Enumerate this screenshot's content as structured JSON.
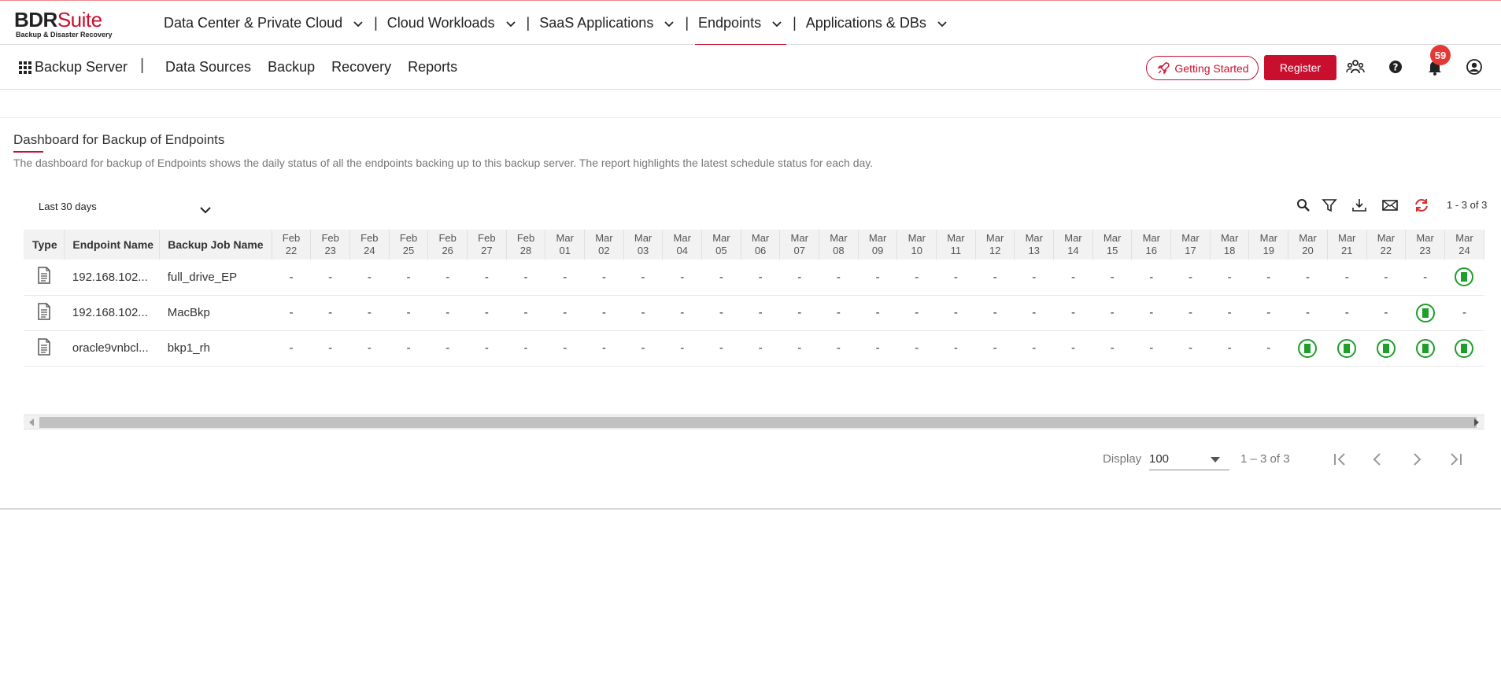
{
  "brand": {
    "name_part1": "BDR",
    "name_part2": "Suite",
    "tagline": "Backup & Disaster Recovery",
    "accent": "#c8102e"
  },
  "topnav": [
    {
      "label": "Data Center & Private Cloud",
      "active": false
    },
    {
      "label": "Cloud Workloads",
      "active": false
    },
    {
      "label": "SaaS Applications",
      "active": false
    },
    {
      "label": "Endpoints",
      "active": true
    },
    {
      "label": "Applications & DBs",
      "active": false
    }
  ],
  "subbar": {
    "server": "Backup Server",
    "nav": [
      "Data Sources",
      "Backup",
      "Recovery",
      "Reports"
    ],
    "getting_started": "Getting Started",
    "register": "Register",
    "notifications_count": "59"
  },
  "page": {
    "title": "Dashboard for Backup of Endpoints",
    "description": "The dashboard for backup of Endpoints shows the daily status of all the endpoints backing up to this backup server. The report highlights the latest schedule status for each day.",
    "range": "Last 30 days",
    "count": "1 - 3 of 3"
  },
  "table": {
    "headers": {
      "type": "Type",
      "endpoint": "Endpoint Name",
      "job": "Backup Job Name"
    },
    "dates": [
      [
        "Feb",
        "22"
      ],
      [
        "Feb",
        "23"
      ],
      [
        "Feb",
        "24"
      ],
      [
        "Feb",
        "25"
      ],
      [
        "Feb",
        "26"
      ],
      [
        "Feb",
        "27"
      ],
      [
        "Feb",
        "28"
      ],
      [
        "Mar",
        "01"
      ],
      [
        "Mar",
        "02"
      ],
      [
        "Mar",
        "03"
      ],
      [
        "Mar",
        "04"
      ],
      [
        "Mar",
        "05"
      ],
      [
        "Mar",
        "06"
      ],
      [
        "Mar",
        "07"
      ],
      [
        "Mar",
        "08"
      ],
      [
        "Mar",
        "09"
      ],
      [
        "Mar",
        "10"
      ],
      [
        "Mar",
        "11"
      ],
      [
        "Mar",
        "12"
      ],
      [
        "Mar",
        "13"
      ],
      [
        "Mar",
        "14"
      ],
      [
        "Mar",
        "15"
      ],
      [
        "Mar",
        "16"
      ],
      [
        "Mar",
        "17"
      ],
      [
        "Mar",
        "18"
      ],
      [
        "Mar",
        "19"
      ],
      [
        "Mar",
        "20"
      ],
      [
        "Mar",
        "21"
      ],
      [
        "Mar",
        "22"
      ],
      [
        "Mar",
        "23"
      ],
      [
        "Mar",
        "24"
      ]
    ],
    "rows": [
      {
        "endpoint": "192.168.102...",
        "job": "full_drive_EP",
        "status": [
          "-",
          "-",
          "-",
          "-",
          "-",
          "-",
          "-",
          "-",
          "-",
          "-",
          "-",
          "-",
          "-",
          "-",
          "-",
          "-",
          "-",
          "-",
          "-",
          "-",
          "-",
          "-",
          "-",
          "-",
          "-",
          "-",
          "-",
          "-",
          "-",
          "-",
          "ok"
        ]
      },
      {
        "endpoint": "192.168.102...",
        "job": "MacBkp",
        "status": [
          "-",
          "-",
          "-",
          "-",
          "-",
          "-",
          "-",
          "-",
          "-",
          "-",
          "-",
          "-",
          "-",
          "-",
          "-",
          "-",
          "-",
          "-",
          "-",
          "-",
          "-",
          "-",
          "-",
          "-",
          "-",
          "-",
          "-",
          "-",
          "-",
          "ok",
          "-"
        ]
      },
      {
        "endpoint": "oracle9vnbcl...",
        "job": "bkp1_rh",
        "status": [
          "-",
          "-",
          "-",
          "-",
          "-",
          "-",
          "-",
          "-",
          "-",
          "-",
          "-",
          "-",
          "-",
          "-",
          "-",
          "-",
          "-",
          "-",
          "-",
          "-",
          "-",
          "-",
          "-",
          "-",
          "-",
          "-",
          "ok",
          "ok",
          "ok",
          "ok",
          "ok"
        ]
      }
    ],
    "ok_color": "#1e9e2a"
  },
  "pager": {
    "display_label": "Display",
    "page_size": "100",
    "range": "1 – 3 of 3"
  }
}
